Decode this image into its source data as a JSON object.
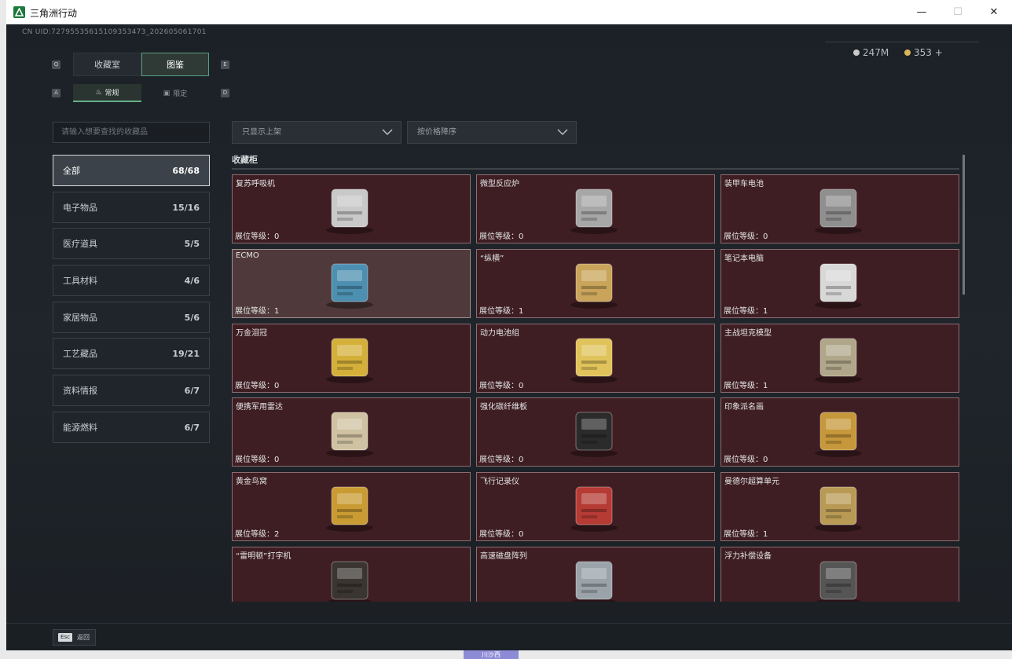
{
  "window": {
    "title": "三角洲行动",
    "minimize": "—",
    "maximize": "☐",
    "close": "✕"
  },
  "header": {
    "uid": "CN UID:72795535615109353473_202605061701",
    "currency": [
      {
        "value": "247M",
        "color": "#c9c9c9"
      },
      {
        "value": "353 +",
        "color": "#d8b45a"
      }
    ]
  },
  "tabs": [
    {
      "label": "收藏室",
      "key": "Q"
    },
    {
      "label": "图鉴",
      "key": "E",
      "active": true
    }
  ],
  "subtabs": [
    {
      "label": "常规",
      "key": "A",
      "active": true
    },
    {
      "label": "限定",
      "key": "D"
    }
  ],
  "search": {
    "placeholder": "请输入想要查找的收藏品"
  },
  "categories": [
    {
      "label": "全部",
      "count": "68/68",
      "active": true
    },
    {
      "label": "电子物品",
      "count": "15/16"
    },
    {
      "label": "医疗道具",
      "count": "5/5"
    },
    {
      "label": "工具材料",
      "count": "4/6"
    },
    {
      "label": "家居物品",
      "count": "5/6"
    },
    {
      "label": "工艺藏品",
      "count": "19/21"
    },
    {
      "label": "资料情报",
      "count": "6/7"
    },
    {
      "label": "能源燃料",
      "count": "6/7"
    }
  ],
  "filters": {
    "shelf": "只显示上架",
    "sort": "按价格降序"
  },
  "section_title": "收藏柜",
  "level_prefix": "展位等级：",
  "items": [
    {
      "name": "复苏呼吸机",
      "level": "0",
      "icon": "ventilator-icon"
    },
    {
      "name": "微型反应炉",
      "level": "0",
      "icon": "reactor-icon"
    },
    {
      "name": "装甲车电池",
      "level": "0",
      "icon": "battery-icon"
    },
    {
      "name": "ECMO",
      "level": "1",
      "icon": "ecmo-icon",
      "highlight": true
    },
    {
      "name": "“纵横”",
      "level": "1",
      "icon": "chessboard-icon"
    },
    {
      "name": "笔记本电脑",
      "level": "1",
      "icon": "laptop-icon"
    },
    {
      "name": "万金泪冠",
      "level": "0",
      "icon": "egg-crown-icon"
    },
    {
      "name": "动力电池组",
      "level": "0",
      "icon": "battery-pack-icon"
    },
    {
      "name": "主战坦克模型",
      "level": "1",
      "icon": "tank-icon"
    },
    {
      "name": "便携军用雷达",
      "level": "0",
      "icon": "radar-icon"
    },
    {
      "name": "强化碳纤维板",
      "level": "0",
      "icon": "carbon-plate-icon"
    },
    {
      "name": "印象派名画",
      "level": "0",
      "icon": "painting-icon"
    },
    {
      "name": "黄金鸟窝",
      "level": "2",
      "icon": "nest-icon"
    },
    {
      "name": "飞行记录仪",
      "level": "0",
      "icon": "flight-recorder-icon"
    },
    {
      "name": "曼德尔超算单元",
      "level": "1",
      "icon": "chip-icon"
    },
    {
      "name": "“雷明顿”打字机",
      "level": "",
      "icon": "typewriter-icon"
    },
    {
      "name": "高速磁盘阵列",
      "level": "",
      "icon": "disk-array-icon"
    },
    {
      "name": "浮力补偿设备",
      "level": "",
      "icon": "bcd-icon"
    }
  ],
  "footer": {
    "key": "Esc",
    "label": "返回"
  },
  "underlay": {
    "tab": "川沙西"
  }
}
